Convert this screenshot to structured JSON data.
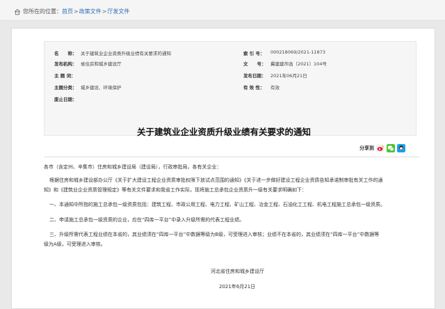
{
  "breadcrumb": {
    "prefix": "您所在的位置：",
    "home": "首页",
    "sep1": ">",
    "policy": "政策文件",
    "sep2": ">",
    "current": "厅发文件"
  },
  "meta": {
    "name_label": "名　　称：",
    "name_value": "关于建筑业企业资质升级业绩有关要求的通知",
    "index_label": "索 引 号：",
    "index_value": "000218069/2021-11873",
    "org_label": "发布机构：",
    "org_value": "省住房和城乡建设厅",
    "doc_label": "文　　号：",
    "doc_value": "冀建建市函〔2021〕104号",
    "subject_label": "主 题 词：",
    "subject_value": "",
    "date_label": "发布日期：",
    "date_value": "2021年06月21日",
    "category_label": "主题分类：",
    "category_value": "城乡建设、环境保护",
    "validity_label": "有 效 性：",
    "validity_value": "有效",
    "repeal_label": "废止日期：",
    "repeal_value": ""
  },
  "title": "关于建筑业企业资质升级业绩有关要求的通知",
  "share": {
    "label": "分享到",
    "icons": [
      "weibo-icon",
      "wechat-icon",
      "qq-icon"
    ],
    "colors": [
      "#e6162d",
      "#51c332",
      "#1aa3e8"
    ]
  },
  "body": {
    "salutation": "各市（含定州、辛集市）住房和城乡建设局（建设局），行政审批局，各有关企业：",
    "para1_line1": "根据住房和城乡建设部办公厅《关于扩大建设工程企业资质审批权限下放试点范围的通知》《关于进一步做好建设工程企业资质告知承诺制审批有关工作的通",
    "para1_line2": "知》和《建筑业企业资质管理规定》等有关文件要求和我省工作实际，现将施工总承包企业资质升一级有关要求明确如下：",
    "item1": "一、本通知中所指的施工总承包一级资质包括：建筑工程、市政公用工程、电力工程、矿山工程、冶金工程、石油化工工程、机电工程施工总承包一级资质。",
    "item2": "二、申请施工总承包一级资质的企业，应在“四库一平台”中录入升级所需的代表工程业绩。",
    "item3_line1": "三、升级所需代表工程业绩在本省的，其业绩须在“四库一平台”中数据等级为B级，可受理进入审核；业绩不在本省的，其业绩须在“四库一平台”中数据等",
    "item3_line2": "级为A级，可受理进入审核。",
    "signature": "河北省住房和城乡建设厅",
    "sign_date": "2021年6月21日"
  }
}
